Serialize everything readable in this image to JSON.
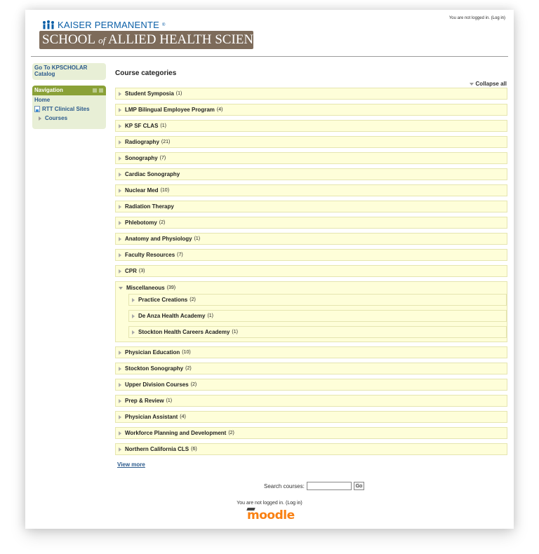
{
  "header": {
    "brand_top": "KAISER PERMANENTE",
    "brand_reg": "®",
    "banner_school": "SCHOOL",
    "banner_of": "of",
    "banner_rest": "ALLIED HEALTH SCIENCES",
    "login_text": "You are not logged in.",
    "login_link": "(Log in)"
  },
  "sidebar": {
    "catalog_link": "Go To KPSCHOLAR Catalog",
    "nav_title": "Navigation",
    "items": [
      {
        "label": "Home"
      },
      {
        "label": "RTT Clinical Sites"
      },
      {
        "label": "Courses"
      }
    ]
  },
  "main": {
    "title": "Course categories",
    "collapse_all": "Collapse all",
    "categories_before": [
      {
        "name": "Student Symposia",
        "count": "(1)"
      },
      {
        "name": "LMP Bilingual Employee Program",
        "count": "(4)"
      },
      {
        "name": "KP SF CLAS",
        "count": "(1)"
      },
      {
        "name": "Radiography",
        "count": "(21)"
      },
      {
        "name": "Sonography",
        "count": "(7)"
      },
      {
        "name": "Cardiac Sonography",
        "count": ""
      },
      {
        "name": "Nuclear Med",
        "count": "(10)"
      },
      {
        "name": "Radiation Therapy",
        "count": ""
      },
      {
        "name": "Phlebotomy",
        "count": "(2)"
      },
      {
        "name": "Anatomy and Physiology",
        "count": "(1)"
      },
      {
        "name": "Faculty Resources",
        "count": "(7)"
      },
      {
        "name": "CPR",
        "count": "(3)"
      }
    ],
    "expanded": {
      "name": "Miscellaneous",
      "count": "(39)",
      "children": [
        {
          "name": "Practice Creations",
          "count": "(2)"
        },
        {
          "name": "De Anza Health Academy",
          "count": "(1)"
        },
        {
          "name": "Stockton Health Careers Academy",
          "count": "(1)"
        }
      ]
    },
    "categories_after": [
      {
        "name": "Physician Education",
        "count": "(10)"
      },
      {
        "name": "Stockton Sonography",
        "count": "(2)"
      },
      {
        "name": "Upper Division Courses",
        "count": "(2)"
      },
      {
        "name": "Prep & Review",
        "count": "(1)"
      },
      {
        "name": "Physician Assistant",
        "count": "(4)"
      },
      {
        "name": "Workforce Planning and Development",
        "count": "(2)"
      },
      {
        "name": "Northern California CLS",
        "count": "(6)"
      }
    ],
    "view_more": "View more"
  },
  "search": {
    "label": "Search courses:",
    "value": "",
    "go_label": "Go"
  },
  "footer": {
    "login_text": "You are not logged in.",
    "login_link": "(Log in)",
    "brand": "moodle"
  },
  "colors": {
    "kp_blue": "#0b5fa7",
    "banner_brown": "#7d6b5a",
    "nav_header_green": "#8aa137",
    "sidebar_bg": "#e8efd6",
    "category_bg": "#fefed9",
    "moodle_orange": "#f98012"
  }
}
